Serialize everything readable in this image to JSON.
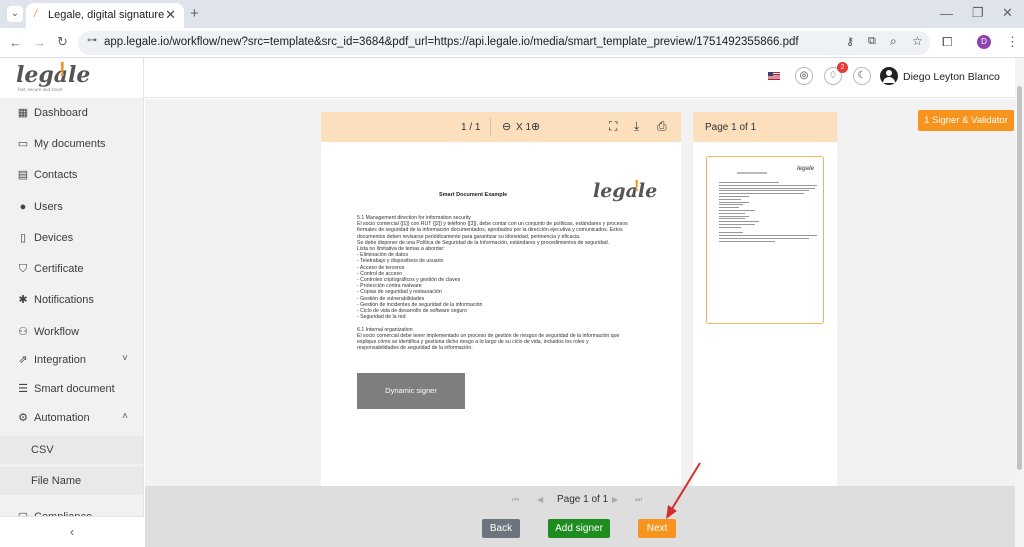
{
  "browser": {
    "tab_title": "Legale, digital signature",
    "url": "app.legale.io/workflow/new?src=template&src_id=3684&pdf_url=https://api.legale.io/media/smart_template_preview/1751492355866.pdf",
    "profile_initial": "D"
  },
  "header": {
    "logo_text": "legale",
    "logo_tagline": "fast, secure and smart",
    "notification_count": "2",
    "user_name": "Diego Leyton Blanco"
  },
  "sidebar": {
    "items": [
      {
        "label": "Dashboard",
        "icon": "dashboard-icon"
      },
      {
        "label": "My documents",
        "icon": "folder-icon"
      },
      {
        "label": "Contacts",
        "icon": "contacts-icon"
      },
      {
        "label": "Users",
        "icon": "user-icon"
      },
      {
        "label": "Devices",
        "icon": "device-icon"
      },
      {
        "label": "Certificate",
        "icon": "shield-icon"
      },
      {
        "label": "Notifications",
        "icon": "bell-icon"
      },
      {
        "label": "Workflow",
        "icon": "workflow-icon"
      },
      {
        "label": "Integration",
        "icon": "external-link-icon"
      },
      {
        "label": "Smart document",
        "icon": "smart-document-icon"
      },
      {
        "label": "Automation",
        "icon": "gear-icon"
      }
    ],
    "automation_sub": [
      "CSV",
      "File Name"
    ],
    "partial_item": "Compliance"
  },
  "viewer": {
    "page_counter": "1 / 1",
    "zoom": "X 1",
    "thumb_header": "Page 1 of 1",
    "signer_button": "1 Signer & Validator"
  },
  "document": {
    "title": "Smart Document Example",
    "logo_text": "legale",
    "lines": [
      "5.1 Management direction for information security",
      "El socio comercial {[1]} con RUT {[2]} y teléfono {[3]}, debe contar con un conjunto de políticas, estándares y procesos",
      "formales de seguridad de la información documentados, aprobados por la dirección ejecutiva y comunicados. Estos",
      "documentos deben revisarse periódicamente para garantizar su idoneidad, pertinencia y eficacia.",
      "Se debe disponer de una Política de Seguridad de la Información, estándares y procedimientos de seguridad.",
      "Lista no limitativa de temas a abordar:",
      "- Eliminación de datos",
      "- Teletrabajo y dispositivos de usuario",
      "- Acceso de terceros",
      "- Control de acceso",
      "- Controles criptográficos y gestión de claves",
      "- Protección contra malware",
      "- Copias de seguridad y restauración",
      "- Gestión de vulnerabilidades",
      "- Gestión de incidentes de seguridad de la información",
      "- Ciclo de vida de desarrollo de software seguro",
      "- Seguridad de la red",
      "",
      "6.1 Internal organization",
      "El socio comercial debe tener implementado un proceso de gestión de riesgos de seguridad de la información que",
      "explique cómo se identifica y gestiona dicho riesgo a lo largo de su ciclo de vida, incluidos los roles y",
      "responsabilidades de seguridad de la información."
    ],
    "signer_box": "Dynamic signer"
  },
  "footer": {
    "pagination": "Page 1 of 1",
    "back": "Back",
    "add_signer": "Add signer",
    "next": "Next"
  },
  "colors": {
    "accent_orange": "#f7941d",
    "peach": "#fce0bd",
    "green": "#1e8c1e",
    "gray_button": "#6c757d",
    "badge_red": "#e53935"
  }
}
